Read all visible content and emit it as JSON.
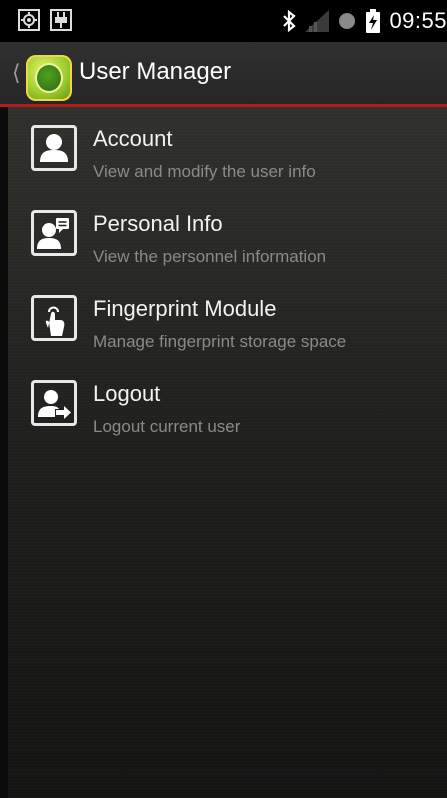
{
  "status_bar": {
    "left_icons": [
      "location-icon",
      "usb-icon"
    ],
    "right_icons": [
      "bluetooth-icon",
      "signal-icon",
      "sync-icon",
      "battery-icon"
    ],
    "time": "09:55"
  },
  "action_bar": {
    "title": "User Manager",
    "up_icon": "chevron-left-icon",
    "app_icon": "app-logo"
  },
  "menu": {
    "items": [
      {
        "title": "Account",
        "subtitle": "View and modify the user info",
        "icon": "user-icon"
      },
      {
        "title": "Personal Info",
        "subtitle": "View the personnel information",
        "icon": "personnel-icon"
      },
      {
        "title": "Fingerprint Module",
        "subtitle": "Manage fingerprint storage space",
        "icon": "fingerprint-icon"
      },
      {
        "title": "Logout",
        "subtitle": "Logout current user",
        "icon": "logout-icon"
      }
    ]
  },
  "colors": {
    "accent_line": "#b41c1c",
    "title_text": "#f2f2f2",
    "subtitle_text": "#8a8a8a"
  }
}
